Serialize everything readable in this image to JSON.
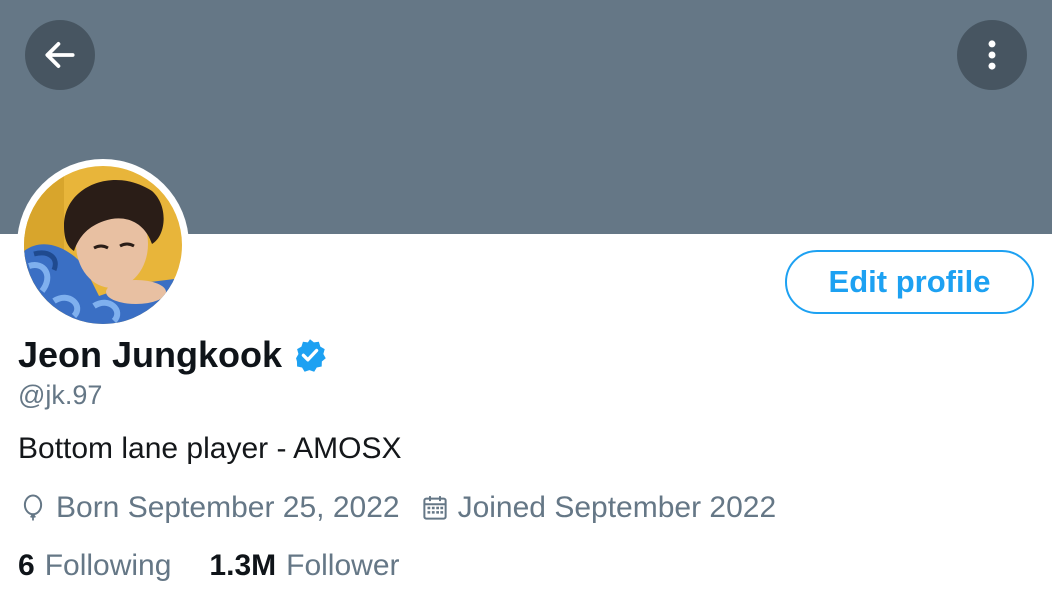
{
  "header": {
    "banner_color": "#657786",
    "back_icon": "arrow-left-icon",
    "more_icon": "more-vertical-icon"
  },
  "profile": {
    "avatar": "avatar",
    "edit_button_label": "Edit profile",
    "name": "Jeon Jungkook",
    "verified_icon": "verified-badge-icon",
    "handle": "@jk.97",
    "bio": "Bottom lane player - AMOSX",
    "born": "Born September 25, 2022",
    "born_icon": "balloon-icon",
    "joined": "Joined September 2022",
    "joined_icon": "calendar-icon"
  },
  "stats": {
    "following_count": "6",
    "following_label": "Following",
    "followers_count": "1.3M",
    "followers_label": "Follower"
  },
  "colors": {
    "accent": "#1da1f2",
    "secondary_text": "#657786",
    "primary_text": "#0f1419"
  }
}
